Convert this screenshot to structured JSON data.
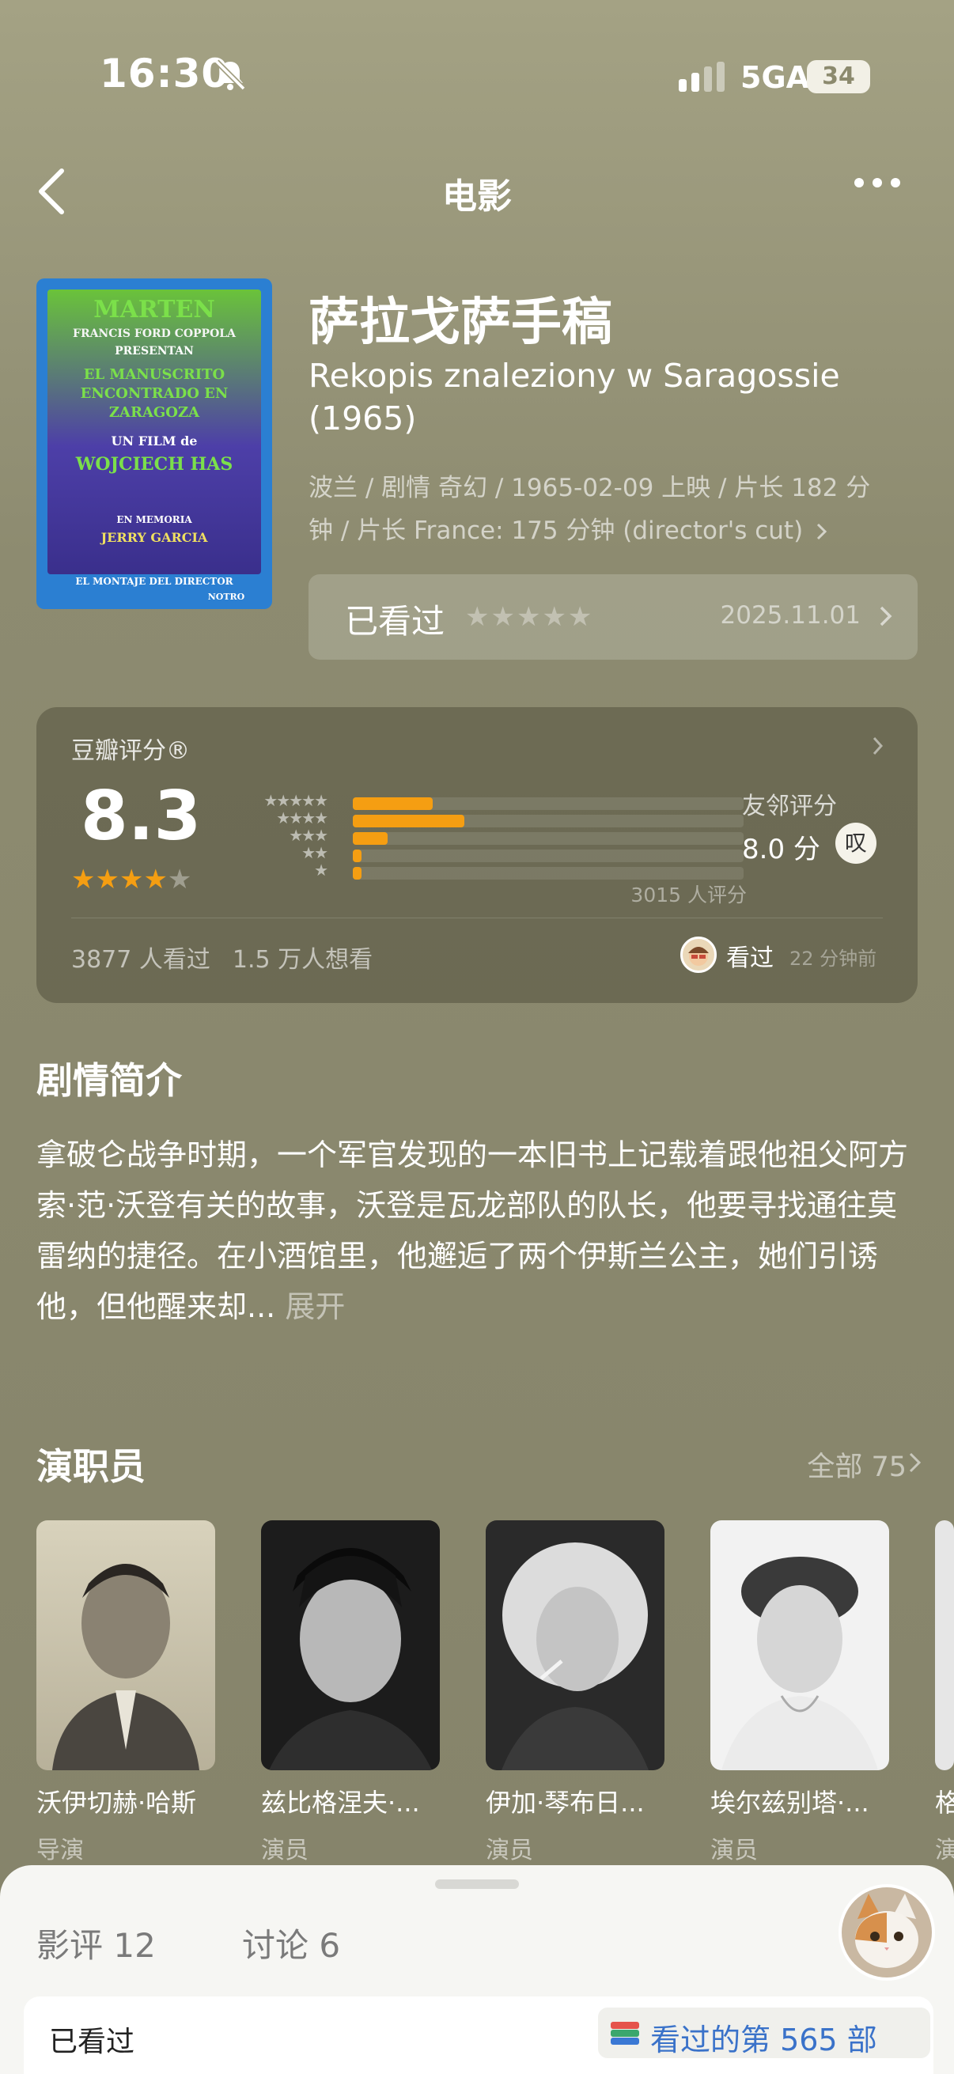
{
  "status_bar": {
    "time": "16:30",
    "network": "5GA",
    "battery": "34"
  },
  "nav": {
    "title": "电影"
  },
  "movie": {
    "title_cn": "萨拉戈萨手稿",
    "title_orig": "Rekopis znaleziony w Saragossie (1965)",
    "meta": "波兰 / 剧情 奇幻 / 1965-02-09 上映 / 片长 182 分钟 / 片长 France: 175 分钟 (director's cut)",
    "poster": {
      "line1": "MARTEN",
      "line2": "FRANCIS FORD COPPOLA",
      "line3": "PRESENTAN",
      "line4": "EL MANUSCRITO ENCONTRADO EN ZARAGOZA",
      "line5": "UN FILM de",
      "line6": "WOJCIECH HAS",
      "line7": "EN MEMORIA",
      "line8": "JERRY GARCIA",
      "footer": "EL MONTAJE DEL DIRECTOR",
      "logo": "NOTRO"
    }
  },
  "watched": {
    "label": "已看过",
    "stars": "★★★★★",
    "date": "2025.11.01"
  },
  "rating": {
    "heading": "豆瓣评分®",
    "score": "8.3",
    "stars_on": "★★★★",
    "stars_off": "★",
    "distribution": [
      {
        "stars": "★★★★★",
        "fraction": 0.205
      },
      {
        "stars": "★★★★",
        "fraction": 0.285
      },
      {
        "stars": "★★★",
        "fraction": 0.09
      },
      {
        "stars": "★★",
        "fraction": 0.022
      },
      {
        "stars": "★",
        "fraction": 0.022
      }
    ],
    "count": "3015 人评分",
    "friend_label": "友邻评分",
    "friend_score": "8.0 分",
    "friend_icon_text": "叹",
    "watched_count": "3877 人看过",
    "wish_count": "1.5 万人想看",
    "friend_watched": "看过",
    "friend_time": "22 分钟前",
    "bar_color": "#f59e12"
  },
  "synopsis": {
    "title": "剧情简介",
    "text": "拿破仑战争时期，一个军官发现的一本旧书上记载着跟他祖父阿方索·范·沃登有关的故事，沃登是瓦龙部队的队长，他要寻找通往莫雷纳的捷径。在小酒馆里，他邂逅了两个伊斯兰公主，她们引诱他，但他醒来却...",
    "expand": "展开"
  },
  "cast": {
    "title": "演职员",
    "all": "全部 75",
    "members": [
      {
        "name": "沃伊切赫·哈斯",
        "role": "导演"
      },
      {
        "name": "兹比格涅夫·...",
        "role": "演员"
      },
      {
        "name": "伊加·琴布日...",
        "role": "演员"
      },
      {
        "name": "埃尔兹别塔·...",
        "role": "演员"
      },
      {
        "name": "格",
        "role": "演"
      }
    ]
  },
  "sheet": {
    "tab_reviews": "影评 12",
    "tab_discussion": "讨论 6",
    "seen_label": "已看过",
    "seen_badge": "看过的第 565 部"
  },
  "icons": {
    "bell": "bell-slash-icon",
    "back": "chevron-left-icon",
    "more": "more-icon",
    "chevron": "chevron-right-icon"
  }
}
